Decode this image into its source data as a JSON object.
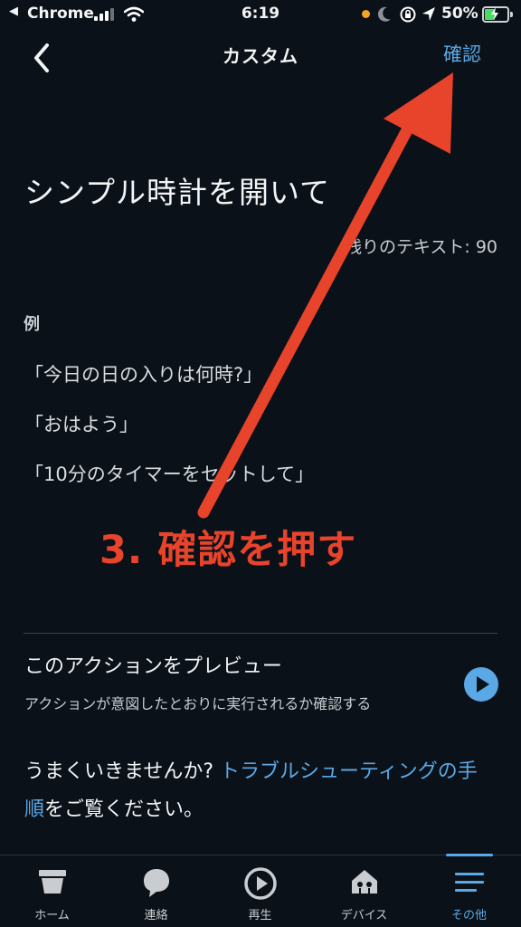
{
  "status_bar": {
    "back_app": "Chrome",
    "time": "6:19",
    "battery_percent": "50%",
    "battery_level": 0.5
  },
  "nav": {
    "title": "カスタム",
    "confirm_label": "確認"
  },
  "content": {
    "phrase": "シンプル時計を開いて",
    "remaining_label": "残りのテキスト:",
    "remaining_count": "90",
    "examples_header": "例",
    "examples": [
      "「今日の日の入りは何時?」",
      "「おはよう」",
      "「10分のタイマーをセットして」"
    ]
  },
  "annotation": {
    "text": "3. 確認を押す",
    "color": "#e8432b"
  },
  "preview": {
    "title": "このアクションをプレビュー",
    "subtitle": "アクションが意図したとおりに実行されるか確認する"
  },
  "troubleshoot": {
    "prefix": "うまくいきませんか? ",
    "link": "トラブルシューティングの手順",
    "suffix": "をご覧ください。"
  },
  "tabs": [
    {
      "label": "ホーム",
      "icon": "home-icon"
    },
    {
      "label": "連絡",
      "icon": "chat-bubble-icon"
    },
    {
      "label": "再生",
      "icon": "play-icon"
    },
    {
      "label": "デバイス",
      "icon": "devices-icon"
    },
    {
      "label": "その他",
      "icon": "menu-icon",
      "active": true
    }
  ],
  "colors": {
    "background": "#0b1118",
    "accent": "#5aa8e6",
    "annotation": "#e8432b"
  }
}
